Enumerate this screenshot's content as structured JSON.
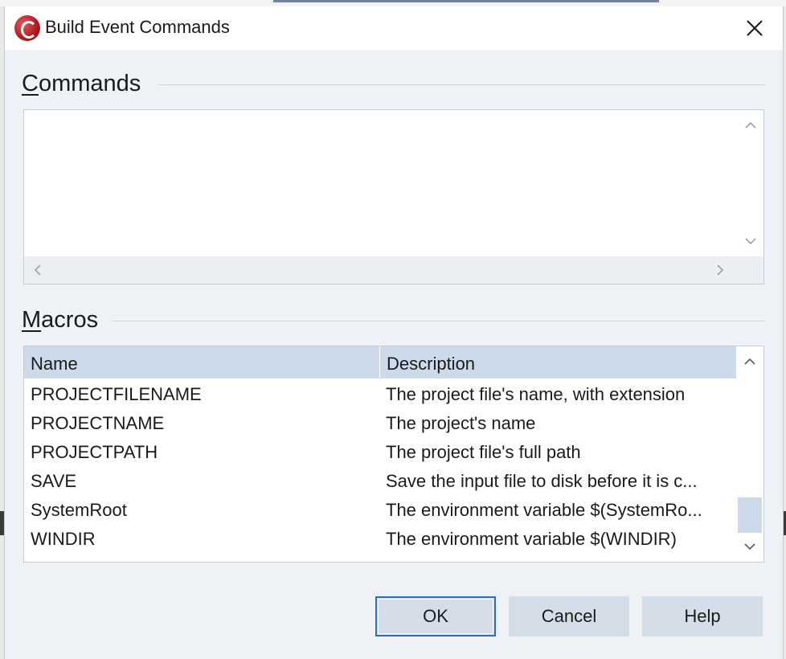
{
  "window": {
    "title": "Build Event Commands"
  },
  "commands": {
    "label_prefix": "C",
    "label_rest": "ommands",
    "text": ""
  },
  "macros": {
    "label_prefix": "M",
    "label_rest": "acros",
    "columns": [
      "Name",
      "Description"
    ],
    "rows": [
      {
        "name": "PROJECTFILENAME",
        "description": "The project file's name, with extension"
      },
      {
        "name": "PROJECTNAME",
        "description": "The project's name"
      },
      {
        "name": "PROJECTPATH",
        "description": "The project file's full path"
      },
      {
        "name": "SAVE",
        "description": "Save the input file to disk before it is c..."
      },
      {
        "name": "SystemRoot",
        "description": "The environment variable $(SystemRo..."
      },
      {
        "name": "WINDIR",
        "description": "The environment variable $(WINDIR)"
      }
    ]
  },
  "buttons": {
    "ok": "OK",
    "cancel": "Cancel",
    "help": "Help"
  },
  "icons": {
    "app": "app-logo-icon",
    "close": "close-icon"
  },
  "colors": {
    "header": "#ccdaea",
    "accent": "#2a6fc4",
    "button": "#d4dde8",
    "panel": "#eef2f7"
  }
}
